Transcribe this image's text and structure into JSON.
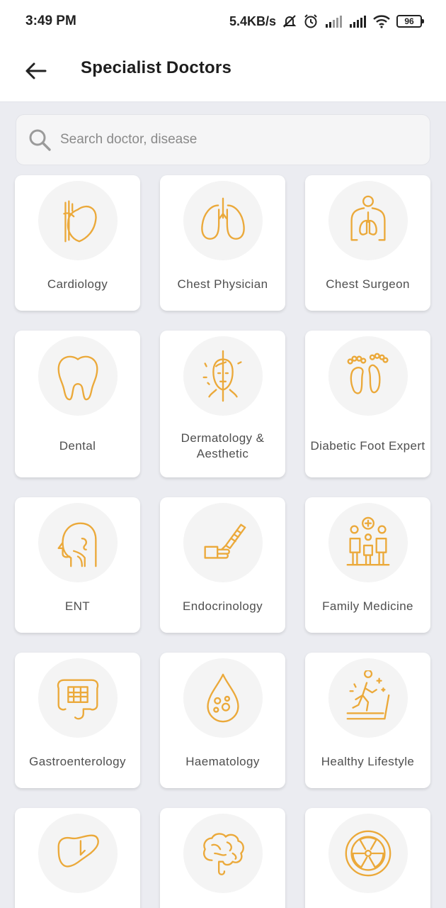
{
  "status_bar": {
    "time": "3:49 PM",
    "speed": "5.4KB/s",
    "battery": "96"
  },
  "header": {
    "title": "Specialist Doctors"
  },
  "search": {
    "placeholder": "Search doctor, disease"
  },
  "colors": {
    "accent": "#eba93a",
    "background": "#ebecf1",
    "card": "#ffffff"
  },
  "specialties": [
    {
      "label": "Cardiology",
      "icon": "heart-icon"
    },
    {
      "label": "Chest Physician",
      "icon": "lungs-icon"
    },
    {
      "label": "Chest Surgeon",
      "icon": "chest-body-icon"
    },
    {
      "label": "Dental",
      "icon": "tooth-icon"
    },
    {
      "label": "Dermatology &\nAesthetic",
      "icon": "face-skin-icon"
    },
    {
      "label": "Diabetic Foot Expert",
      "icon": "feet-icon"
    },
    {
      "label": "ENT",
      "icon": "head-profile-icon"
    },
    {
      "label": "Endocrinology",
      "icon": "insulin-pen-icon"
    },
    {
      "label": "Family Medicine",
      "icon": "family-icon"
    },
    {
      "label": "Gastroenterology",
      "icon": "intestine-icon"
    },
    {
      "label": "Haematology",
      "icon": "blood-drop-icon"
    },
    {
      "label": "Healthy Lifestyle",
      "icon": "treadmill-icon"
    },
    {
      "label": "",
      "icon": "liver-icon"
    },
    {
      "label": "",
      "icon": "brain-icon"
    },
    {
      "label": "",
      "icon": "radiation-icon"
    }
  ]
}
